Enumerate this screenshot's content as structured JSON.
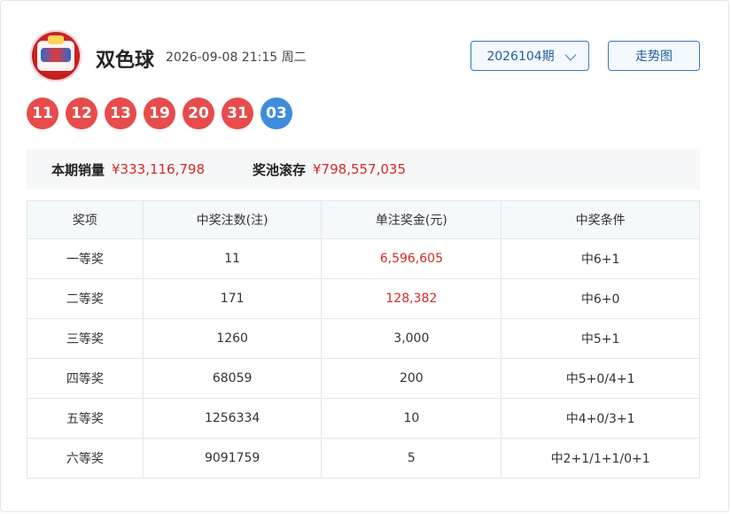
{
  "header": {
    "title": "双色球",
    "datetime": "2026-09-08 21:15 周二",
    "period_select": "2026104期",
    "trend_button": "走势图"
  },
  "balls": {
    "red": [
      "11",
      "12",
      "13",
      "19",
      "20",
      "31"
    ],
    "blue": [
      "03"
    ]
  },
  "summary": {
    "sales_label": "本期销量",
    "sales_value": "¥333,116,798",
    "pool_label": "奖池滚存",
    "pool_value": "¥798,557,035"
  },
  "table": {
    "headers": [
      "奖项",
      "中奖注数(注)",
      "单注奖金(元)",
      "中奖条件"
    ],
    "rows": [
      {
        "prize": "一等奖",
        "count": "11",
        "amount": "6,596,605",
        "condition": "中6+1"
      },
      {
        "prize": "二等奖",
        "count": "171",
        "amount": "128,382",
        "condition": "中6+0"
      },
      {
        "prize": "三等奖",
        "count": "1260",
        "amount": "3,000",
        "condition": "中5+1"
      },
      {
        "prize": "四等奖",
        "count": "68059",
        "amount": "200",
        "condition": "中5+0/4+1"
      },
      {
        "prize": "五等奖",
        "count": "1256334",
        "amount": "10",
        "condition": "中4+0/3+1"
      },
      {
        "prize": "六等奖",
        "count": "9091759",
        "amount": "5",
        "condition": "中2+1/1+1/0+1"
      }
    ]
  },
  "colors": {
    "red_ball": "#e84b4b",
    "blue_ball": "#3f8cdc",
    "accent": "#2f79c6",
    "highlight_text": "#d42a2a"
  },
  "icons": {
    "logo": "union-lotto-logo-icon",
    "dropdown": "chevron-down-icon"
  }
}
